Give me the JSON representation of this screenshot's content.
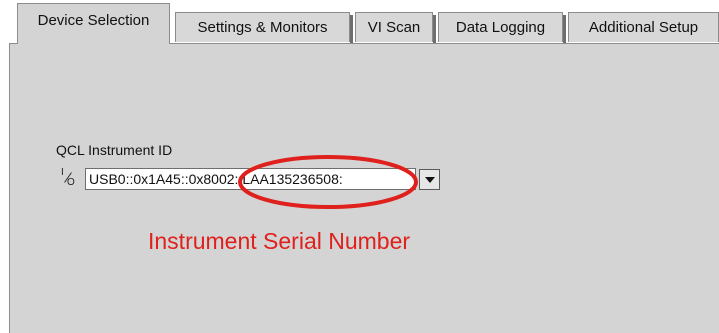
{
  "tabs": [
    {
      "label": "Device Selection",
      "active": true
    },
    {
      "label": "Settings & Monitors",
      "active": false
    },
    {
      "label": "VI Scan",
      "active": false
    },
    {
      "label": "Data Logging",
      "active": false
    },
    {
      "label": "Additional Setup",
      "active": false
    }
  ],
  "instrument": {
    "label": "QCL Instrument ID",
    "io_glyph_top": "I",
    "io_glyph_bottom": "O",
    "value": "USB0::0x1A45::0x8002::LAA135236508:",
    "dropdown_icon": "chevron-down-icon"
  },
  "annotation": {
    "text": "Instrument Serial Number",
    "color": "#e0201c"
  },
  "colors": {
    "panel": "#d4d4d4",
    "callout": "#e0201c"
  }
}
